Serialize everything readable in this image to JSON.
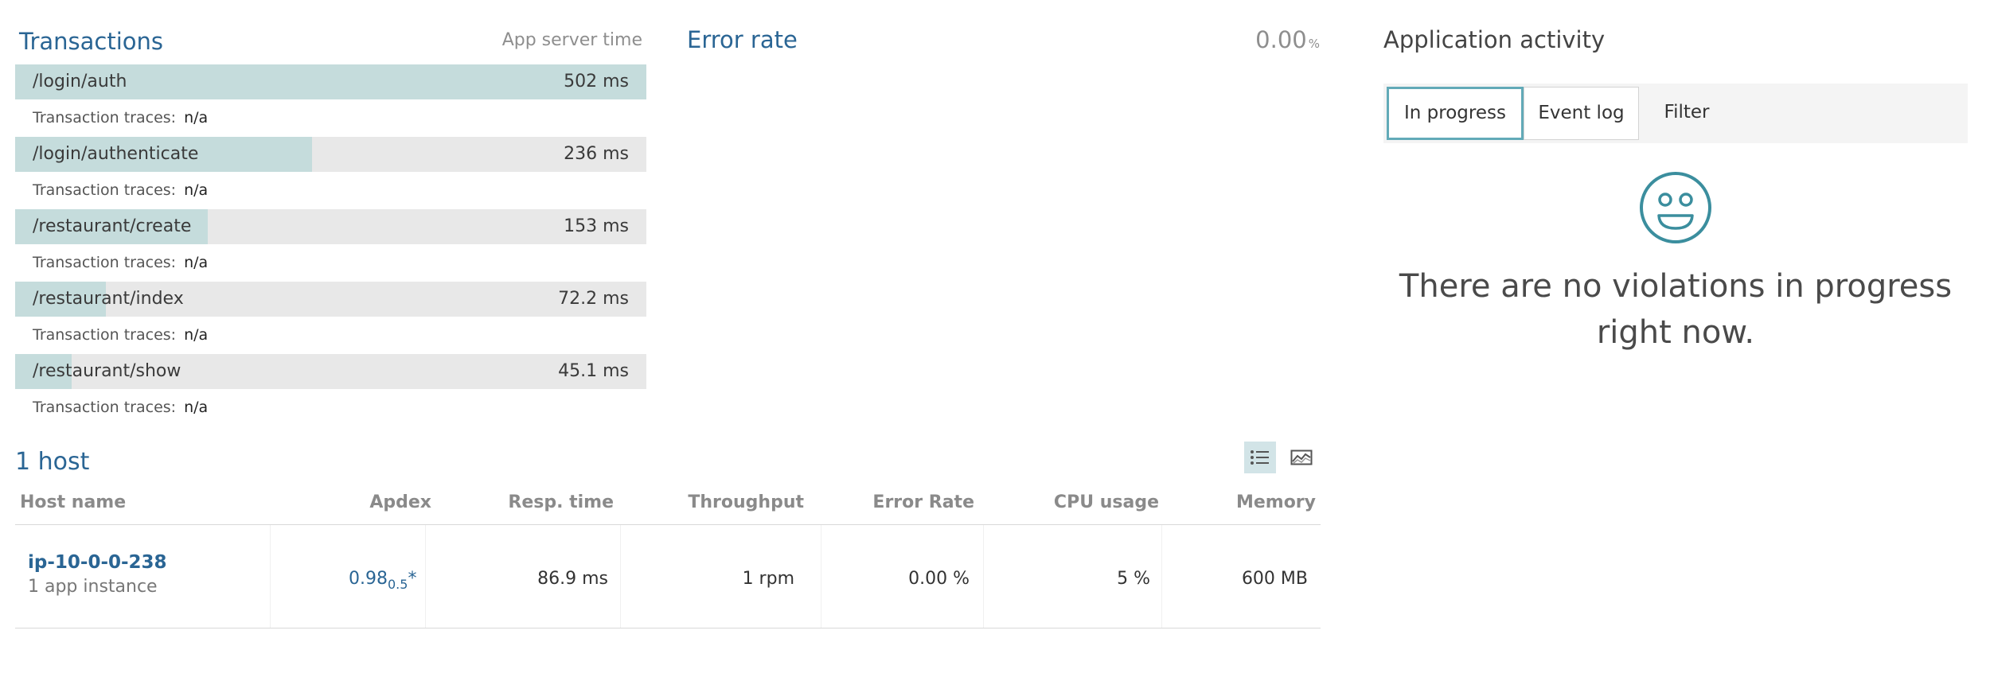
{
  "transactions": {
    "title": "Transactions",
    "subtitle": "App server time",
    "traces_label": "Transaction traces:",
    "items": [
      {
        "name": "/login/auth",
        "value": "502 ms",
        "traces": "n/a",
        "fill_fraction": 1.0
      },
      {
        "name": "/login/authenticate",
        "value": "236 ms",
        "traces": "n/a",
        "fill_fraction": 0.47
      },
      {
        "name": "/restaurant/create",
        "value": "153 ms",
        "traces": "n/a",
        "fill_fraction": 0.305
      },
      {
        "name": "/restaurant/index",
        "value": "72.2 ms",
        "traces": "n/a",
        "fill_fraction": 0.144
      },
      {
        "name": "/restaurant/show",
        "value": "45.1 ms",
        "traces": "n/a",
        "fill_fraction": 0.09
      }
    ]
  },
  "error_rate": {
    "title": "Error rate",
    "value": "0.00",
    "unit": "%"
  },
  "activity": {
    "title": "Application activity",
    "tabs": [
      {
        "label": "In progress",
        "active": true
      },
      {
        "label": "Event log",
        "active": false
      },
      {
        "label": "Filter",
        "active": false
      }
    ],
    "smiley_icon": "smiley-face-icon",
    "empty_message": "There are no violations in progress right now."
  },
  "hosts": {
    "title": "1 host",
    "view_icons": [
      "list-view-icon",
      "chart-view-icon"
    ],
    "columns": [
      "Host name",
      "Apdex",
      "Resp. time",
      "Throughput",
      "Error Rate",
      "CPU usage",
      "Memory"
    ],
    "rows": [
      {
        "host_name": "ip-10-0-0-238",
        "instances": "1 app instance",
        "apdex_score": "0.98",
        "apdex_t": "0.5",
        "apdex_mark": "*",
        "resp_time": "86.9 ms",
        "throughput": "1 rpm",
        "error_rate": "0.00 %",
        "cpu_usage": "5 %",
        "memory": "600 MB"
      }
    ]
  },
  "colors": {
    "accent_blue": "#2a6594",
    "bar_fill": "#c5dcdc",
    "bar_track": "#e8e8e8",
    "tab_active_border": "#62aab8",
    "smiley_teal": "#3b8e9e"
  }
}
